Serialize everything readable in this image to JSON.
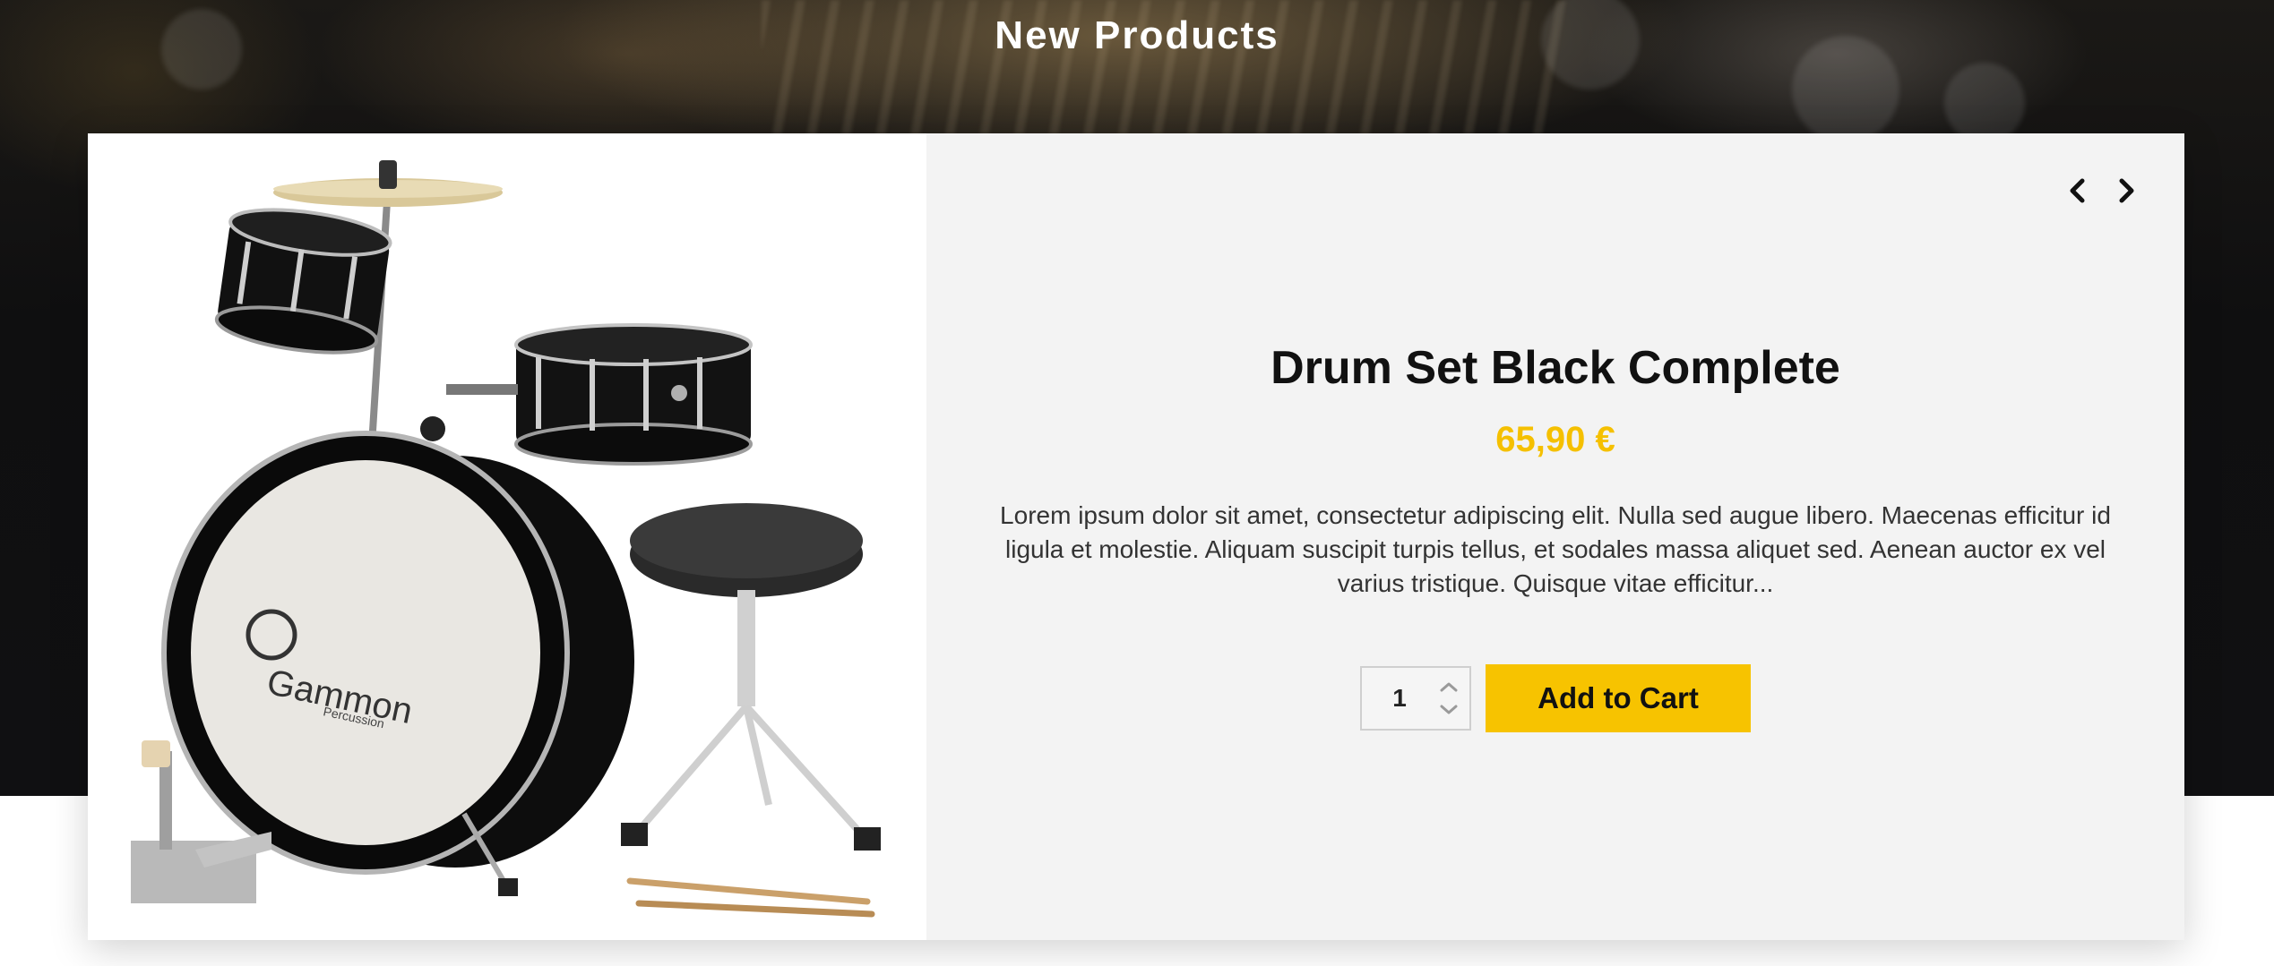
{
  "section": {
    "title": "New Products"
  },
  "product": {
    "name": "Drum Set Black Complete",
    "price": "65,90 €",
    "description": "Lorem ipsum dolor sit amet, consectetur adipiscing elit. Nulla sed augue libero. Maecenas efficitur id ligula et molestie. Aliquam suscipit turpis tellus, et sodales massa aliquet sed. Aenean auctor ex vel varius tristique. Quisque vitae efficitur...",
    "image_brand": "Gammon",
    "image_brand_sub": "Percussion",
    "quantity": "1",
    "add_to_cart_label": "Add to Cart"
  },
  "carousel": {
    "prev_icon": "chevron-left-icon",
    "next_icon": "chevron-right-icon"
  },
  "colors": {
    "accent": "#f7c300",
    "price": "#f5c000",
    "card_bg": "#f3f3f3",
    "hero_bg": "#111111"
  }
}
